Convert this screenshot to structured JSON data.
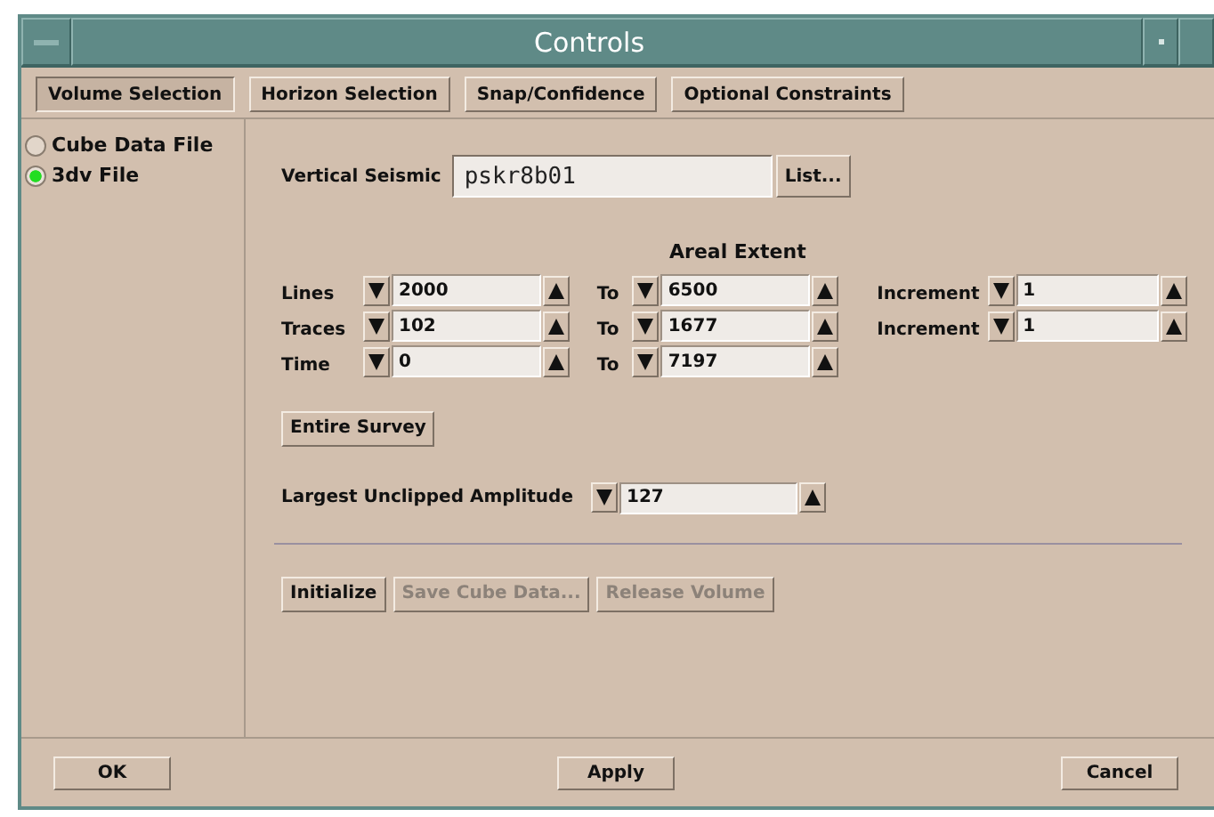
{
  "window": {
    "title": "Controls"
  },
  "tabs": [
    {
      "label": "Volume Selection",
      "selected": true
    },
    {
      "label": "Horizon Selection",
      "selected": false
    },
    {
      "label": "Snap/Confidence",
      "selected": false
    },
    {
      "label": "Optional Constraints",
      "selected": false
    }
  ],
  "sources": [
    {
      "label": "Cube Data File",
      "selected": false
    },
    {
      "label": "3dv File",
      "selected": true
    }
  ],
  "vertical_seismic": {
    "label": "Vertical Seismic",
    "value": "pskr8b01",
    "button": "List..."
  },
  "areal_extent": {
    "heading": "Areal Extent",
    "rows": [
      {
        "label": "Lines",
        "from": "2000",
        "to_label": "To",
        "to": "6500",
        "increment_label": "Increment",
        "increment": "1"
      },
      {
        "label": "Traces",
        "from": "102",
        "to_label": "To",
        "to": "1677",
        "increment_label": "Increment",
        "increment": "1"
      },
      {
        "label": "Time",
        "from": "0",
        "to_label": "To",
        "to": "7197"
      }
    ]
  },
  "entire_survey_button": "Entire Survey",
  "amplitude": {
    "label": "Largest Unclipped Amplitude",
    "value": "127"
  },
  "actions": [
    {
      "label": "Initialize",
      "disabled": false
    },
    {
      "label": "Save Cube Data...",
      "disabled": true
    },
    {
      "label": "Release Volume",
      "disabled": true
    }
  ],
  "footer_buttons": [
    "OK",
    "Apply",
    "Cancel"
  ]
}
